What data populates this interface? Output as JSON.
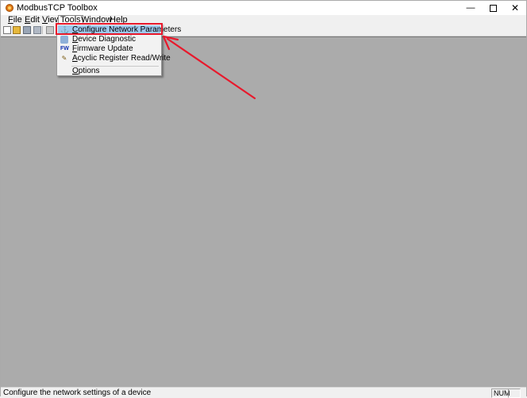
{
  "window": {
    "title": "ModbusTCP Toolbox",
    "controls": {
      "minimize": "—",
      "close": "✕"
    }
  },
  "menubar": {
    "items": [
      {
        "mnemonic": "F",
        "rest": "ile"
      },
      {
        "mnemonic": "E",
        "rest": "dit"
      },
      {
        "mnemonic": "V",
        "rest": "iew"
      },
      {
        "mnemonic": "T",
        "rest": "ools"
      },
      {
        "mnemonic": "W",
        "rest": "indow"
      },
      {
        "mnemonic": "H",
        "rest": "elp"
      }
    ],
    "open_menu": "Tools"
  },
  "toolbar": {
    "buttons": [
      "new-icon",
      "open-folder-icon",
      "save-icon",
      "save-all-icon",
      "print-icon"
    ]
  },
  "tools_menu": {
    "items": [
      {
        "mnemonic": "C",
        "rest": "onfigure Network Parameters",
        "icon": "network-config-icon",
        "selected": true
      },
      {
        "mnemonic": "D",
        "rest": "evice Diagnostic",
        "icon": "diagnostic-icon"
      },
      {
        "mnemonic": "F",
        "rest": "irmware Update",
        "icon": "firmware-update-icon",
        "icon_text": "FW"
      },
      {
        "mnemonic": "A",
        "rest": "cyclic Register Read/Write",
        "icon": "register-rw-icon"
      },
      {
        "mnemonic": "O",
        "rest": "ptions"
      }
    ]
  },
  "statusbar": {
    "message": "Configure the network settings of a device",
    "num": "NUM"
  },
  "annotation": {
    "highlight_color": "#e8192c"
  }
}
